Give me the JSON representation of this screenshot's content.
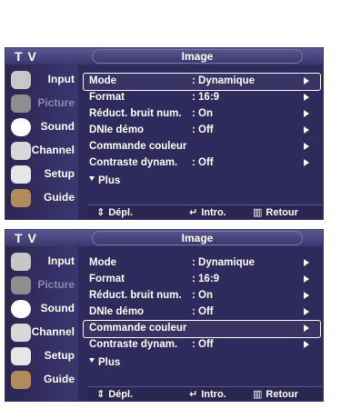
{
  "panels": [
    {
      "header": {
        "title": "T V",
        "menu_title": "Image"
      },
      "sidebar": [
        {
          "label": "Input",
          "icon": "input-icon",
          "color": "#c7c7c7",
          "dim": false
        },
        {
          "label": "Picture",
          "icon": "picture-icon",
          "color": "#8e8e8e",
          "dim": true
        },
        {
          "label": "Sound",
          "icon": "sound-icon",
          "color": "#ffffff",
          "dim": false
        },
        {
          "label": "Channel",
          "icon": "channel-icon",
          "color": "#d8d8d8",
          "dim": false
        },
        {
          "label": "Setup",
          "icon": "setup-icon",
          "color": "#e6e6e6",
          "dim": false
        },
        {
          "label": "Guide",
          "icon": "guide-icon",
          "color": "#b18c5a",
          "dim": false
        }
      ],
      "rows": [
        {
          "label": "Mode",
          "value": ": Dynamique",
          "arrow": true
        },
        {
          "label": "Format",
          "value": ": 16:9",
          "arrow": true
        },
        {
          "label": "Réduct. bruit num.",
          "value": ": On",
          "arrow": true
        },
        {
          "label": "DNIe démo",
          "value": ": Off",
          "arrow": true
        },
        {
          "label": "Commande couleur",
          "value": "",
          "arrow": true
        },
        {
          "label": "Contraste dynam.",
          "value": ": Off",
          "arrow": true
        }
      ],
      "selected_row": 0,
      "plus": "Plus",
      "bottom": {
        "move": "Dépl.",
        "enter": "Intro.",
        "return": "Retour"
      }
    },
    {
      "header": {
        "title": "T V",
        "menu_title": "Image"
      },
      "sidebar": [
        {
          "label": "Input",
          "icon": "input-icon",
          "color": "#c7c7c7",
          "dim": false
        },
        {
          "label": "Picture",
          "icon": "picture-icon",
          "color": "#8e8e8e",
          "dim": true
        },
        {
          "label": "Sound",
          "icon": "sound-icon",
          "color": "#ffffff",
          "dim": false
        },
        {
          "label": "Channel",
          "icon": "channel-icon",
          "color": "#d8d8d8",
          "dim": false
        },
        {
          "label": "Setup",
          "icon": "setup-icon",
          "color": "#e6e6e6",
          "dim": false
        },
        {
          "label": "Guide",
          "icon": "guide-icon",
          "color": "#b18c5a",
          "dim": false
        }
      ],
      "rows": [
        {
          "label": "Mode",
          "value": ": Dynamique",
          "arrow": true
        },
        {
          "label": "Format",
          "value": ": 16:9",
          "arrow": true
        },
        {
          "label": "Réduct. bruit num.",
          "value": ": On",
          "arrow": true
        },
        {
          "label": "DNIe démo",
          "value": ": Off",
          "arrow": true
        },
        {
          "label": "Commande couleur",
          "value": "",
          "arrow": true
        },
        {
          "label": "Contraste dynam.",
          "value": ": Off",
          "arrow": true
        }
      ],
      "selected_row": 4,
      "plus": "Plus",
      "bottom": {
        "move": "Dépl.",
        "enter": "Intro.",
        "return": "Retour"
      }
    }
  ]
}
